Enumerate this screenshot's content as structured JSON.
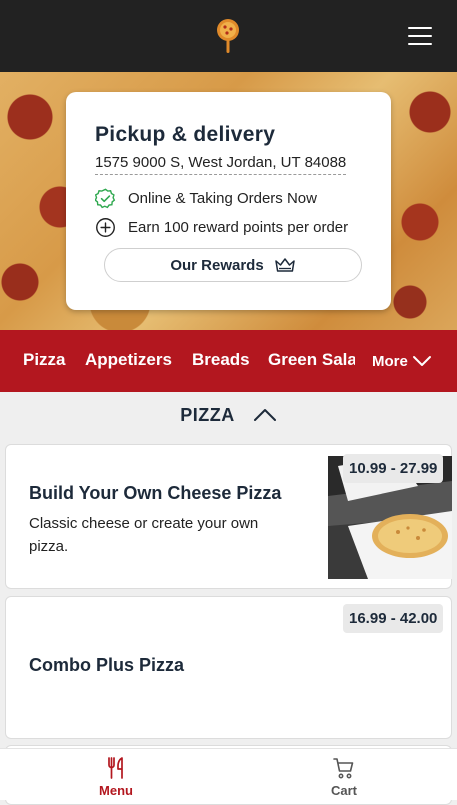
{
  "header": {
    "logo_icon": "pizza-peel-logo-icon",
    "menu_icon": "hamburger-menu-icon"
  },
  "store_card": {
    "title": "Pickup & delivery",
    "address": "1575 9000 S, West Jordan, UT 84088",
    "status": "Online & Taking Orders Now",
    "status_icon": "check-badge-icon",
    "status_color": "#2fa84f",
    "rewards_info": "Earn 100 reward points per order",
    "rewards_info_icon": "plus-circle-icon",
    "rewards_button": "Our Rewards",
    "rewards_button_icon": "crown-icon"
  },
  "categories": {
    "items": [
      "Pizza",
      "Appetizers",
      "Breads",
      "Green Sala"
    ],
    "more_label": "More",
    "more_icon": "chevron-down-icon",
    "bar_color": "#b3171f"
  },
  "section": {
    "title": "PIZZA",
    "toggle_icon": "chevron-up-icon"
  },
  "menu_items": [
    {
      "name": "Build Your Own Cheese Pizza",
      "description": "Classic cheese or create your own pizza.",
      "price": "10.99 - 27.99",
      "image": "cheese-pizza-in-box"
    },
    {
      "name": "Combo Plus Pizza",
      "description": "",
      "price": "16.99 - 42.00"
    }
  ],
  "bottom_nav": {
    "menu_label": "Menu",
    "menu_icon": "fork-knife-icon",
    "cart_label": "Cart",
    "cart_icon": "cart-icon",
    "active_color": "#b3171f",
    "inactive_color": "#555555"
  }
}
